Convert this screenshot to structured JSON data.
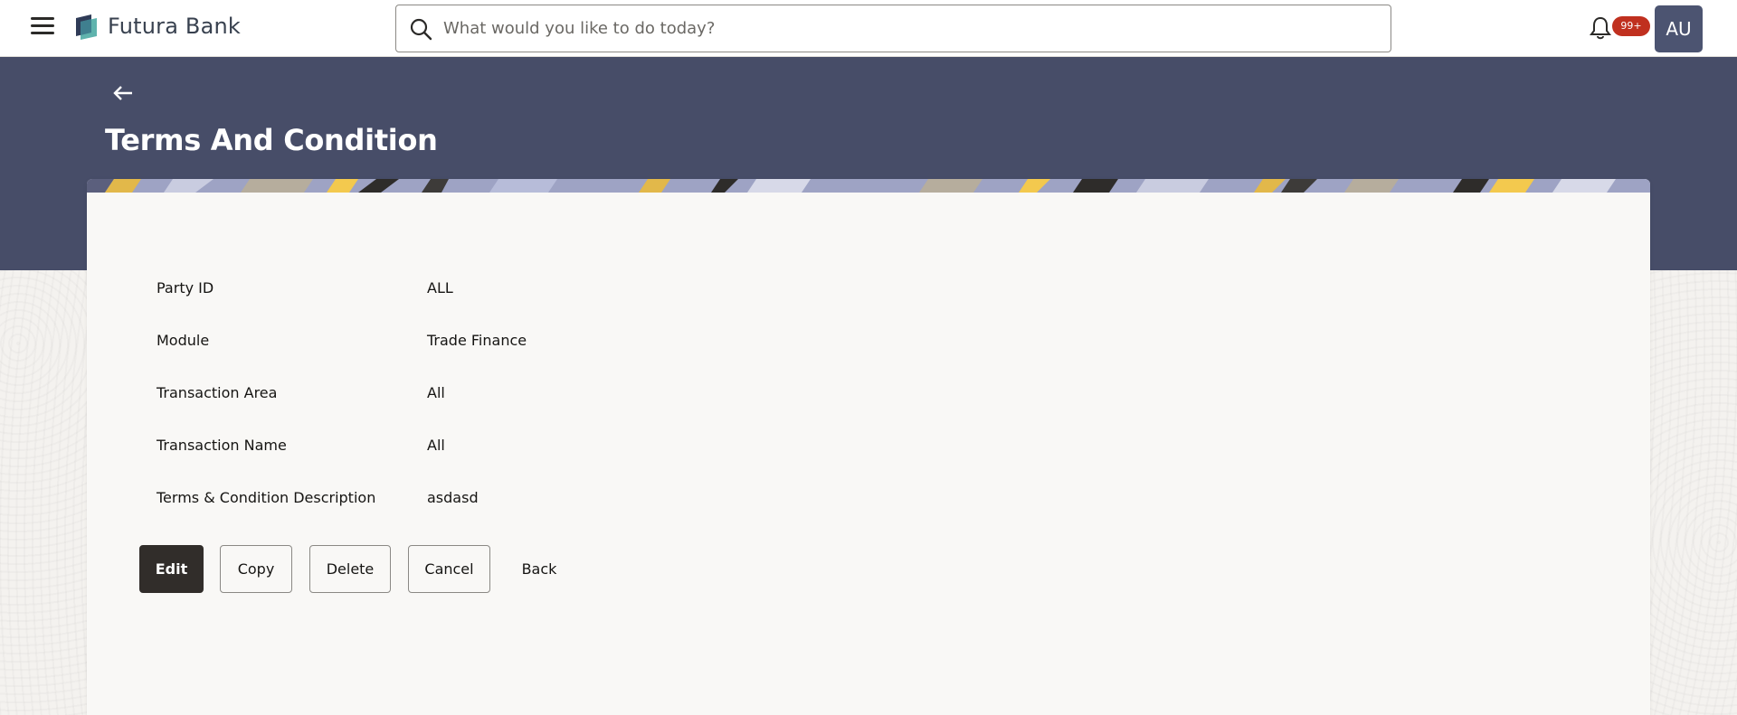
{
  "header": {
    "brand": "Futura Bank",
    "search_placeholder": "What would you like to do today?",
    "notification_count": "99+",
    "avatar_initials": "AU",
    "icons": {
      "menu": "hamburger-menu-icon",
      "logo": "futura-bank-logo",
      "search": "search-icon",
      "bell": "bell-icon"
    }
  },
  "page": {
    "title": "Terms And Condition",
    "back_icon": "arrow-left-icon"
  },
  "details": [
    {
      "label": "Party ID",
      "value": "ALL"
    },
    {
      "label": "Module",
      "value": "Trade Finance"
    },
    {
      "label": "Transaction Area",
      "value": "All"
    },
    {
      "label": "Transaction Name",
      "value": "All"
    },
    {
      "label": "Terms & Condition Description",
      "value": "asdasd"
    }
  ],
  "actions": {
    "edit": "Edit",
    "copy": "Copy",
    "delete": "Delete",
    "cancel": "Cancel",
    "back": "Back"
  },
  "colors": {
    "banner": "#474d68",
    "primary_button": "#312d2a",
    "badge": "#c0301f",
    "avatar": "#4c5471"
  }
}
